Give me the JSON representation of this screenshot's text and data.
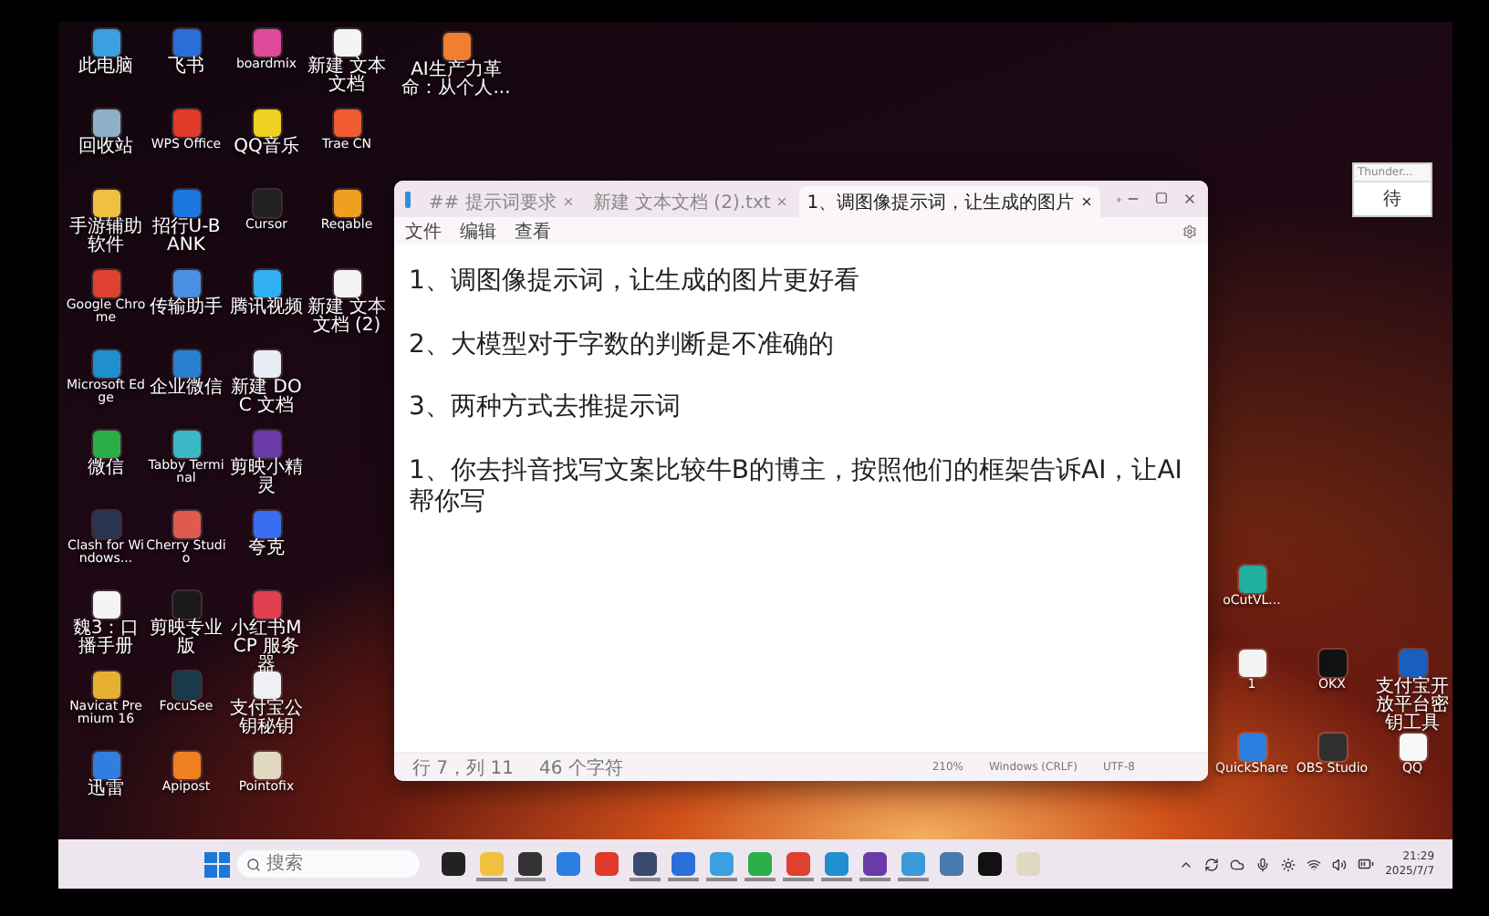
{
  "desktop_icons": [
    {
      "label": "此电脑",
      "color": "#3aa0e0"
    },
    {
      "label": "回收站",
      "color": "#8fb0c8"
    },
    {
      "label": "手游辅助软件",
      "color": "#f0c040"
    },
    {
      "label": "Google Chrome",
      "color": "#e04030"
    },
    {
      "label": "Microsoft Edge",
      "color": "#1f8fd0"
    },
    {
      "label": "微信",
      "color": "#2aae48"
    },
    {
      "label": "Clash for Windows...",
      "color": "#2a3550"
    },
    {
      "label": "魏3：口播手册",
      "color": "#f4f4f4"
    },
    {
      "label": "Navicat Premium 16",
      "color": "#e8b030"
    },
    {
      "label": "迅雷",
      "color": "#2f7fe0"
    },
    {
      "label": "飞书",
      "color": "#2a6fd8"
    },
    {
      "label": "WPS Office",
      "color": "#e03a2a"
    },
    {
      "label": "招行U-BANK",
      "color": "#1a78e0"
    },
    {
      "label": "传输助手",
      "color": "#4a90e2"
    },
    {
      "label": "企业微信",
      "color": "#2a7fd0"
    },
    {
      "label": "Tabby Terminal",
      "color": "#3ab8c8"
    },
    {
      "label": "Cherry Studio",
      "color": "#e05a50"
    },
    {
      "label": "剪映专业版",
      "color": "#1a1a1a"
    },
    {
      "label": "FocuSee",
      "color": "#1a3a4a"
    },
    {
      "label": "Apipost",
      "color": "#f08020"
    },
    {
      "label": "boardmix",
      "color": "#e04a9a"
    },
    {
      "label": "QQ音乐",
      "color": "#f0d020"
    },
    {
      "label": "Cursor",
      "color": "#222222"
    },
    {
      "label": "腾讯视频",
      "color": "#30b0f0"
    },
    {
      "label": "新建 DOC 文档",
      "color": "#e8ecf4"
    },
    {
      "label": "剪映小精灵",
      "color": "#6a3aa8"
    },
    {
      "label": "夸克",
      "color": "#3a6ef0"
    },
    {
      "label": "小红书MCP 服务器",
      "color": "#e04050"
    },
    {
      "label": "支付宝公钥秘钥",
      "color": "#f0f0f4"
    },
    {
      "label": "Pointofix",
      "color": "#e0d8c0"
    },
    {
      "label": "新建 文本文档",
      "color": "#f4f4f4"
    },
    {
      "label": "Trae CN",
      "color": "#f05a30"
    },
    {
      "label": "Reqable",
      "color": "#f0a020"
    },
    {
      "label": "新建 文本文档 (2)",
      "color": "#f4f4f4"
    }
  ],
  "top_icon": {
    "label": "AI生产力革命：从个人...",
    "color": "#f08030"
  },
  "right_icons": [
    {
      "label": "oCutVL...",
      "color": "#20b0a0"
    },
    {
      "label": "1",
      "color": "#f4f4f4"
    },
    {
      "label": "OKX",
      "color": "#111111"
    },
    {
      "label": "支付宝开放平台密钥工具",
      "color": "#1a5fc0"
    },
    {
      "label": "QuickShare",
      "color": "#2a7fe0"
    },
    {
      "label": "OBS Studio",
      "color": "#303030"
    },
    {
      "label": "QQ",
      "color": "#f8f8f8"
    }
  ],
  "mini_window": {
    "title": "Thunder...",
    "button": "待"
  },
  "notepad": {
    "tabs": [
      {
        "label": "## 提示词要求",
        "selected": false
      },
      {
        "label": "新建 文本文档 (2).txt",
        "selected": false
      },
      {
        "label": "1、调图像提示词，让生成的图片",
        "selected": true
      }
    ],
    "menu": [
      "文件",
      "编辑",
      "查看"
    ],
    "lines": [
      "1、调图像提示词，让生成的图片更好看",
      "2、大模型对于字数的判断是不准确的",
      "3、两种方式去推提示词",
      "1、你去抖音找写文案比较牛B的博主，按照他们的框架告诉AI，让AI帮你写"
    ],
    "status": {
      "position": "行 7，列 11",
      "chars": "46 个字符",
      "zoom": "210%",
      "line_ending": "Windows (CRLF)",
      "encoding": "UTF-8"
    }
  },
  "taskbar": {
    "search_placeholder": "搜索",
    "apps": [
      {
        "color": "#222222",
        "open": false
      },
      {
        "color": "#f0c040",
        "open": true
      },
      {
        "color": "#333333",
        "open": true
      },
      {
        "color": "#2a7fe0",
        "open": false
      },
      {
        "color": "#e03a2a",
        "open": false
      },
      {
        "color": "#3a4a6a",
        "open": true
      },
      {
        "color": "#2a6fd8",
        "open": true
      },
      {
        "color": "#3aa0e0",
        "open": true
      },
      {
        "color": "#2aae48",
        "open": true
      },
      {
        "color": "#e04030",
        "open": true
      },
      {
        "color": "#1f8fd0",
        "open": true
      },
      {
        "color": "#6a3aa8",
        "open": true
      },
      {
        "color": "#3a9ad8",
        "open": true
      },
      {
        "color": "#4a7ab0",
        "open": false
      },
      {
        "color": "#111111",
        "open": false
      },
      {
        "color": "#e0d8c0",
        "open": false
      }
    ],
    "time": "21:29",
    "date": "2025/7/7"
  }
}
